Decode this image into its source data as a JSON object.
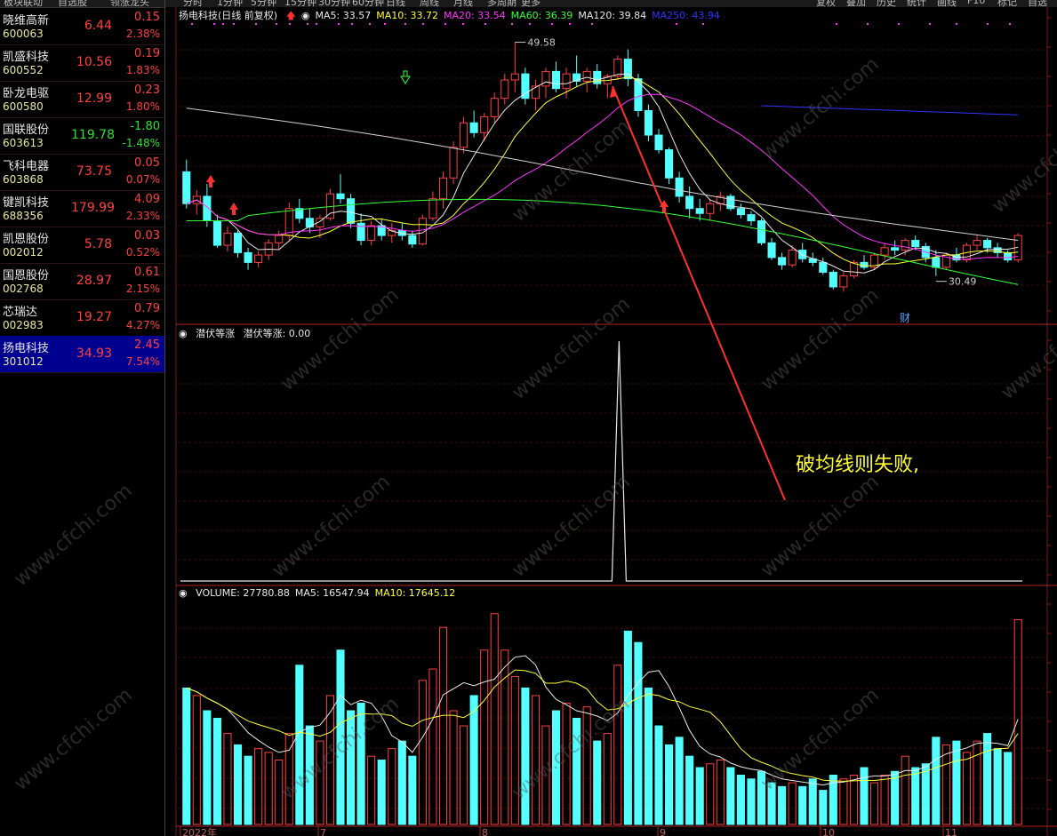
{
  "sidebar": {
    "headers": [
      "板块联动",
      "自选股",
      "领涨龙头"
    ],
    "stocks": [
      {
        "name": "晓维高新",
        "code": "600063",
        "price": "6.44",
        "chg": "0.15",
        "pct": "2.38%",
        "dir": "up"
      },
      {
        "name": "凯盛科技",
        "code": "600552",
        "price": "10.56",
        "chg": "0.19",
        "pct": "1.83%",
        "dir": "up"
      },
      {
        "name": "卧龙电驱",
        "code": "600580",
        "price": "12.99",
        "chg": "0.23",
        "pct": "1.80%",
        "dir": "up"
      },
      {
        "name": "国联股份",
        "code": "603613",
        "price": "119.78",
        "chg": "-1.80",
        "pct": "-1.48%",
        "dir": "down"
      },
      {
        "name": "飞科电器",
        "code": "603868",
        "price": "73.75",
        "chg": "0.05",
        "pct": "0.07%",
        "dir": "up"
      },
      {
        "name": "键凯科技",
        "code": "688356",
        "price": "179.99",
        "chg": "4.09",
        "pct": "2.33%",
        "dir": "up"
      },
      {
        "name": "凯恩股份",
        "code": "002012",
        "price": "5.78",
        "chg": "0.03",
        "pct": "0.52%",
        "dir": "up"
      },
      {
        "name": "国恩股份",
        "code": "002768",
        "price": "28.97",
        "chg": "0.61",
        "pct": "2.15%",
        "dir": "up"
      },
      {
        "name": "芯瑞达",
        "code": "002983",
        "price": "19.27",
        "chg": "0.79",
        "pct": "4.27%",
        "dir": "up"
      },
      {
        "name": "扬电科技",
        "code": "301012",
        "price": "34.93",
        "chg": "2.45",
        "pct": "7.54%",
        "dir": "up",
        "active": true
      }
    ]
  },
  "toolbar": {
    "periods": [
      "分时",
      "1分钟",
      "5分钟",
      "15分钟",
      "30分钟",
      "60分钟",
      "日线",
      "周线",
      "月线",
      "多周期",
      "更多"
    ],
    "right_items": [
      "复权",
      "叠加",
      "历史",
      "统计",
      "画线",
      "F10",
      "标记",
      "自选"
    ]
  },
  "main_chart": {
    "title": "扬电科技(日线 前复权)",
    "ma_labels": [
      {
        "text": "MA5: 33.57",
        "color": "#e8e8e8"
      },
      {
        "text": "MA10: 33.72",
        "color": "#ffff33"
      },
      {
        "text": "MA20: 33.54",
        "color": "#ff33ff"
      },
      {
        "text": "MA60: 36.39",
        "color": "#33ff33"
      },
      {
        "text": "MA120: 39.84",
        "color": "#e8e8e8"
      },
      {
        "text": "MA250: 43.94",
        "color": "#3333ff"
      }
    ],
    "high_label": "49.58",
    "low_label": "30.49",
    "event_marker": "财"
  },
  "indicator": {
    "title": "潜伏等涨",
    "value_label": "潜伏等涨: 0.00"
  },
  "volume": {
    "labels": [
      {
        "text": "VOLUME: 27780.88",
        "color": "#e8e8e8"
      },
      {
        "text": "MA5: 16547.94",
        "color": "#e8e8e8"
      },
      {
        "text": "MA10: 17645.12",
        "color": "#ffff33"
      }
    ]
  },
  "x_axis": [
    "2022年",
    "7",
    "8",
    "9",
    "10",
    "11"
  ],
  "annotation": "破均线则失败,",
  "watermark": "www.cfchi.com",
  "colors": {
    "up": "#ff4040",
    "down": "#54ffff",
    "ma5": "#e8e8e8",
    "ma10": "#ffff33",
    "ma20": "#ff33ff",
    "ma60": "#33ff33",
    "ma120": "#d0d0d0",
    "ma250": "#3333ff"
  },
  "chart_data": {
    "type": "candlestick",
    "title": "扬电科技(日线 前复权)",
    "ohlc": [
      [
        39.0,
        40.0,
        36.0,
        36.4
      ],
      [
        36.4,
        37.5,
        35.5,
        37.0
      ],
      [
        37.0,
        38.0,
        34.5,
        35.0
      ],
      [
        35.0,
        35.5,
        32.8,
        33.0
      ],
      [
        33.0,
        34.5,
        32.5,
        34.0
      ],
      [
        34.0,
        34.2,
        32.0,
        32.4
      ],
      [
        32.4,
        32.8,
        31.0,
        31.6
      ],
      [
        31.6,
        32.5,
        31.2,
        32.2
      ],
      [
        32.2,
        33.5,
        31.8,
        33.2
      ],
      [
        33.2,
        34.2,
        32.6,
        33.8
      ],
      [
        33.8,
        36.5,
        33.4,
        36.0
      ],
      [
        36.0,
        36.8,
        34.8,
        35.2
      ],
      [
        35.2,
        36.0,
        34.0,
        34.5
      ],
      [
        34.5,
        35.5,
        33.6,
        35.2
      ],
      [
        35.2,
        37.6,
        35.0,
        37.2
      ],
      [
        37.2,
        38.8,
        36.4,
        36.8
      ],
      [
        36.8,
        37.2,
        34.4,
        34.8
      ],
      [
        34.8,
        35.6,
        33.0,
        33.4
      ],
      [
        33.4,
        35.0,
        33.0,
        34.6
      ],
      [
        34.6,
        35.2,
        33.4,
        33.8
      ],
      [
        33.8,
        34.8,
        33.2,
        34.2
      ],
      [
        34.2,
        34.8,
        33.4,
        33.8
      ],
      [
        33.8,
        34.2,
        32.8,
        33.1
      ],
      [
        33.1,
        35.5,
        33.0,
        35.2
      ],
      [
        35.2,
        37.4,
        35.0,
        36.8
      ],
      [
        36.8,
        39.0,
        36.0,
        38.5
      ],
      [
        38.5,
        41.5,
        38.0,
        41.0
      ],
      [
        41.0,
        43.5,
        40.5,
        43.0
      ],
      [
        43.0,
        44.0,
        41.8,
        42.2
      ],
      [
        42.2,
        43.8,
        41.5,
        43.5
      ],
      [
        43.5,
        45.5,
        43.0,
        45.0
      ],
      [
        45.0,
        47.0,
        44.5,
        46.5
      ],
      [
        46.5,
        49.58,
        45.5,
        47.0
      ],
      [
        47.0,
        47.5,
        44.5,
        45.0
      ],
      [
        45.0,
        46.5,
        44.0,
        46.0
      ],
      [
        46.0,
        47.5,
        45.0,
        47.2
      ],
      [
        47.2,
        48.0,
        45.5,
        45.8
      ],
      [
        45.8,
        47.5,
        45.0,
        47.0
      ],
      [
        47.0,
        48.5,
        46.0,
        46.4
      ],
      [
        46.4,
        47.5,
        45.5,
        47.2
      ],
      [
        47.2,
        47.8,
        45.8,
        46.2
      ],
      [
        46.2,
        47.0,
        45.0,
        46.8
      ],
      [
        46.8,
        48.5,
        46.5,
        48.2
      ],
      [
        48.2,
        49.0,
        46.0,
        46.6
      ],
      [
        46.6,
        47.0,
        43.5,
        44.0
      ],
      [
        44.0,
        44.5,
        41.5,
        42.0
      ],
      [
        42.0,
        42.5,
        40.5,
        40.8
      ],
      [
        40.8,
        41.0,
        38.0,
        38.5
      ],
      [
        38.5,
        39.0,
        36.5,
        37.0
      ],
      [
        37.0,
        37.8,
        35.2,
        36.0
      ],
      [
        36.0,
        36.8,
        35.0,
        35.6
      ],
      [
        35.6,
        36.8,
        35.0,
        36.4
      ],
      [
        36.4,
        37.4,
        35.8,
        37.0
      ],
      [
        37.0,
        37.2,
        35.8,
        36.0
      ],
      [
        36.0,
        36.4,
        35.2,
        35.5
      ],
      [
        35.5,
        35.8,
        34.6,
        35.0
      ],
      [
        35.0,
        35.2,
        33.0,
        33.2
      ],
      [
        33.2,
        33.6,
        31.8,
        32.0
      ],
      [
        32.0,
        32.4,
        31.0,
        31.4
      ],
      [
        31.4,
        33.0,
        31.2,
        32.6
      ],
      [
        32.6,
        33.2,
        31.6,
        31.9
      ],
      [
        31.9,
        32.4,
        31.3,
        31.6
      ],
      [
        31.6,
        32.0,
        30.6,
        30.8
      ],
      [
        30.8,
        31.0,
        29.4,
        29.6
      ],
      [
        29.6,
        30.8,
        29.2,
        30.5
      ],
      [
        30.5,
        31.8,
        30.3,
        31.6
      ],
      [
        31.6,
        32.2,
        31.0,
        31.2
      ],
      [
        31.2,
        32.4,
        31.0,
        32.2
      ],
      [
        32.2,
        33.2,
        31.8,
        32.8
      ],
      [
        32.8,
        33.4,
        32.2,
        32.6
      ],
      [
        32.6,
        33.6,
        32.2,
        33.4
      ],
      [
        33.4,
        33.8,
        32.6,
        32.9
      ],
      [
        32.9,
        33.2,
        31.6,
        32.0
      ],
      [
        32.0,
        32.6,
        30.49,
        31.2
      ],
      [
        31.2,
        32.4,
        31.0,
        32.2
      ],
      [
        32.2,
        32.8,
        31.6,
        31.8
      ],
      [
        31.8,
        33.2,
        31.6,
        33.0
      ],
      [
        33.0,
        33.8,
        32.6,
        33.4
      ],
      [
        33.4,
        33.6,
        32.4,
        32.8
      ],
      [
        32.8,
        33.2,
        32.0,
        32.4
      ],
      [
        32.4,
        32.6,
        31.6,
        31.8
      ],
      [
        31.8,
        34.0,
        31.6,
        33.8
      ]
    ],
    "indicator_values": "0 except single spike to 1.0 at bar 43",
    "volume_note": "27780.88 latest volume"
  }
}
